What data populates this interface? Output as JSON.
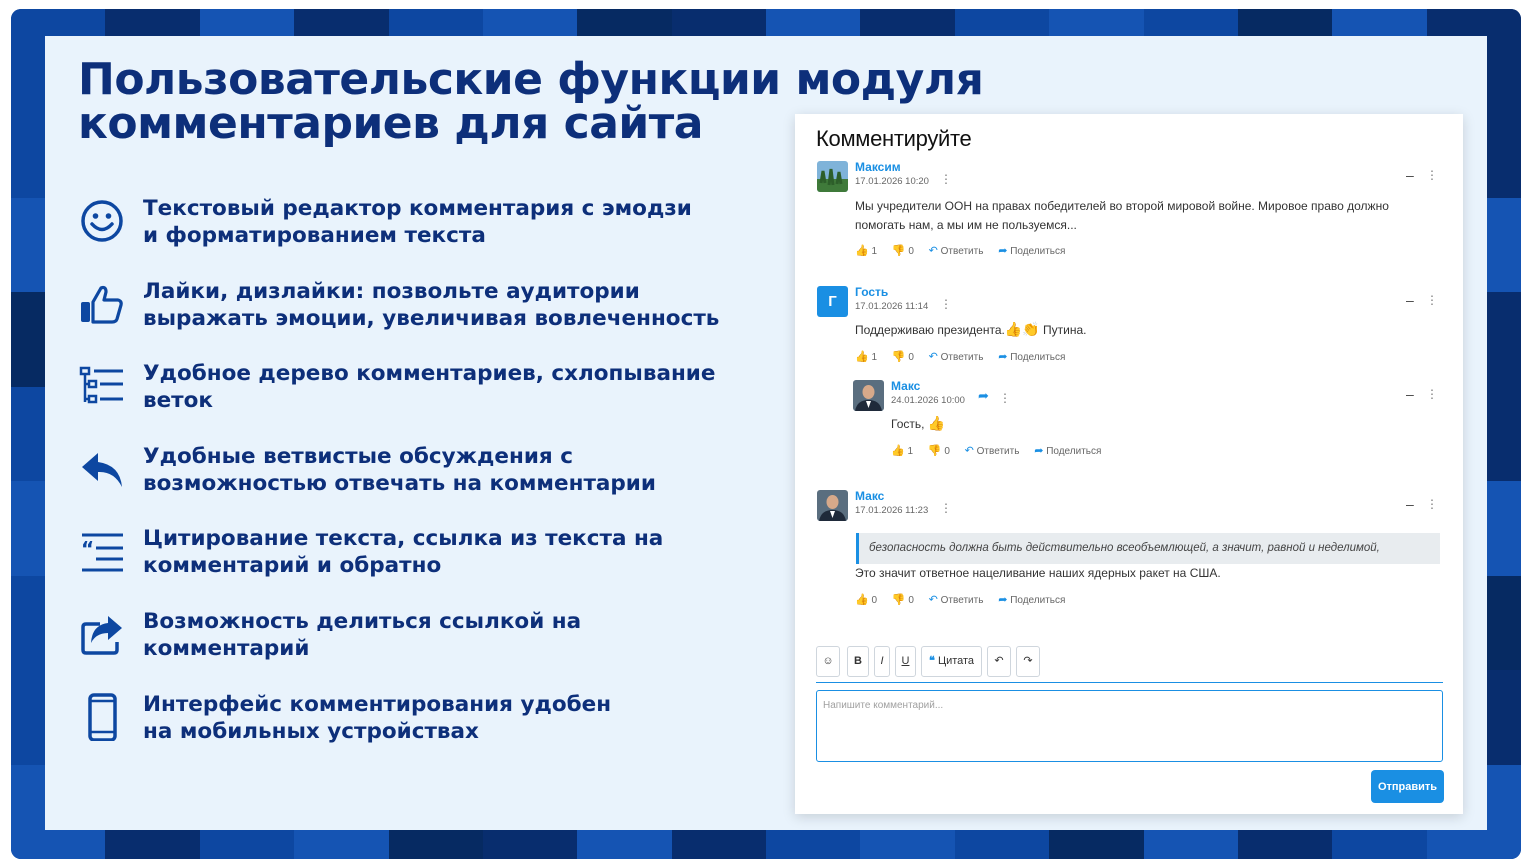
{
  "slide": {
    "title_line1": "Пользовательские функции модуля",
    "title_line2": "комментариев для сайта",
    "features": [
      {
        "icon": "smiley-icon",
        "line1": "Текстовый редактор комментария с эмодзи",
        "line2": "и форматированием текста"
      },
      {
        "icon": "thumbs-up-icon",
        "line1": "Лайки, дизлайки: позвольте аудитории",
        "line2": "выражать эмоции, увеличивая вовлеченность"
      },
      {
        "icon": "tree-list-icon",
        "line1": "Удобное дерево комментариев, схлопывание",
        "line2": "веток"
      },
      {
        "icon": "reply-arrow-icon",
        "line1": "Удобные ветвистые обсуждения с",
        "line2": "возможностью отвечать на комментарии"
      },
      {
        "icon": "quote-lines-icon",
        "line1": "Цитирование текста, ссылка из текста на",
        "line2": "комментарий и обратно"
      },
      {
        "icon": "share-box-icon",
        "line1": "Возможность делиться ссылкой на",
        "line2": "комментарий"
      },
      {
        "icon": "mobile-phone-icon",
        "line1": "Интерфейс комментирования удобен",
        "line2": "на мобильных устройствах"
      }
    ],
    "colors": {
      "primary": "#0d2f7a",
      "accent": "#1a8fe3",
      "panel_bg": "#e9f3fc"
    }
  },
  "widget": {
    "title": "Комментируйте",
    "comments": [
      {
        "author": "Максим",
        "date": "17.01.2026 10:20",
        "text_line1": "Мы учредители ООН на правах победителей во второй мировой войне. Мировое право должно",
        "text_line2": "помогать нам, а мы им не пользуемся...",
        "likes": "1",
        "dislikes": "0",
        "reply": "Ответить",
        "share": "Поделиться"
      },
      {
        "author": "Гость",
        "avatar_letter": "Г",
        "date": "17.01.2026 11:14",
        "text_before": "Поддерживаю президента.",
        "text_after": " Путина.",
        "likes": "1",
        "dislikes": "0",
        "reply": "Ответить",
        "share": "Поделиться"
      },
      {
        "author": "Макс",
        "date": "24.01.2026 10:00",
        "text": "Гость,",
        "likes": "1",
        "dislikes": "0",
        "reply": "Ответить",
        "share": "Поделиться"
      },
      {
        "author": "Макс",
        "date": "17.01.2026 11:23",
        "quote": "безопасность должна быть действительно всеобъемлющей, а значит, равной и неделимой,",
        "text": "Это значит ответное нацеливание наших ядерных ракет на США.",
        "likes": "0",
        "dislikes": "0",
        "reply": "Ответить",
        "share": "Поделиться"
      }
    ],
    "toolbar": {
      "bold": "B",
      "italic": "I",
      "underline": "U",
      "quote": "Цитата"
    },
    "placeholder": "Напишите комментарий...",
    "send_label": "Отправить"
  }
}
